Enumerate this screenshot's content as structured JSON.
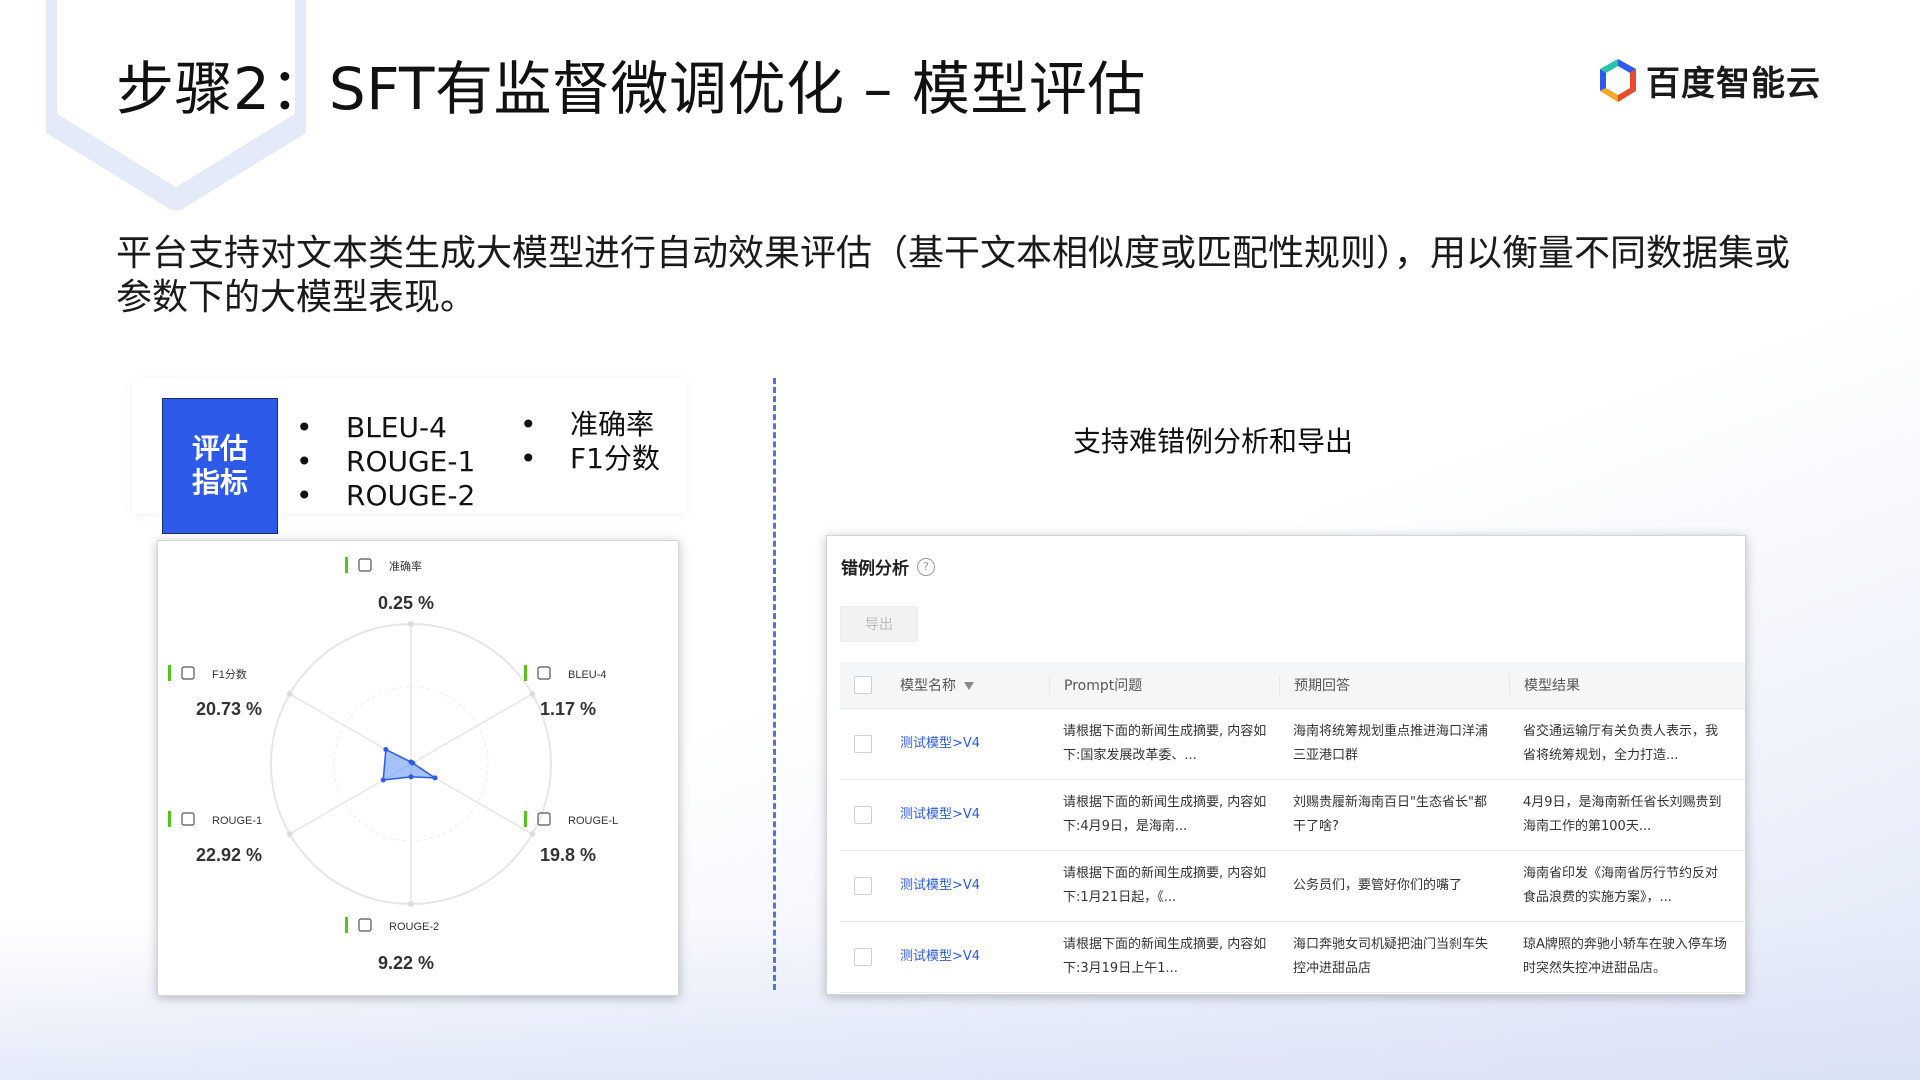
{
  "title": "步骤2：SFT有监督微调优化 – 模型评估",
  "brand": {
    "name": "百度智能云",
    "icon": "baidu-cloud-logo-icon"
  },
  "intro": "平台支持对文本类生成大模型进行自动效果评估（基干文本相似度或匹配性规则），用以衡量不同数据集或参数下的大模型表现。",
  "metrics": {
    "badge": [
      "评估",
      "指标"
    ],
    "list_left": [
      "BLEU-4",
      "ROUGE-1",
      "ROUGE-2"
    ],
    "list_right": [
      "准确率",
      "F1分数"
    ]
  },
  "chart_data": {
    "type": "radar",
    "axes": [
      "准确率",
      "BLEU-4",
      "ROUGE-L",
      "ROUGE-2",
      "ROUGE-1",
      "F1分数"
    ],
    "values": [
      0.25,
      1.17,
      19.8,
      9.22,
      22.92,
      20.73
    ],
    "value_labels": [
      "0.25 %",
      "1.17 %",
      "19.8 %",
      "9.22 %",
      "22.92 %",
      "20.73 %"
    ],
    "colors": {
      "fill": "#5b8ff9",
      "stroke": "#2d5ae8",
      "accent": "#52c41a"
    }
  },
  "caption": "支持难错例分析和导出",
  "analysis": {
    "title": "错例分析",
    "help_icon": "?",
    "export_label": "导出",
    "columns": [
      "模型名称",
      "Prompt问题",
      "预期回答",
      "模型结果"
    ],
    "rows": [
      {
        "model": "测试模型>V4",
        "prompt": [
          "请根据下面的新闻生成摘要, 内容如",
          "下:国家发展改革委、..."
        ],
        "expected": [
          "海南将统筹规划重点推进海口洋浦",
          "三亚港口群"
        ],
        "result": [
          "省交通运输厅有关负责人表示，我",
          "省将统筹规划，全力打造..."
        ]
      },
      {
        "model": "测试模型>V4",
        "prompt": [
          "请根据下面的新闻生成摘要, 内容如",
          "下:4月9日，是海南..."
        ],
        "expected": [
          "刘赐贵履新海南百日\"生态省长\"都",
          "干了啥?"
        ],
        "result": [
          "4月9日，是海南新任省长刘赐贵到",
          "海南工作的第100天..."
        ]
      },
      {
        "model": "测试模型>V4",
        "prompt": [
          "请根据下面的新闻生成摘要, 内容如",
          "下:1月21日起，《..."
        ],
        "expected": [
          "公务员们，要管好你们的嘴了",
          ""
        ],
        "result": [
          "海南省印发《海南省厉行节约反对",
          "食品浪费的实施方案》，..."
        ]
      },
      {
        "model": "测试模型>V4",
        "prompt": [
          "请根据下面的新闻生成摘要, 内容如",
          "下:3月19日上午1..."
        ],
        "expected": [
          "海口奔驰女司机疑把油门当刹车失",
          "控冲进甜品店"
        ],
        "result": [
          "琼A牌照的奔驰小轿车在驶入停车场",
          "时突然失控冲进甜品店。"
        ]
      }
    ]
  }
}
